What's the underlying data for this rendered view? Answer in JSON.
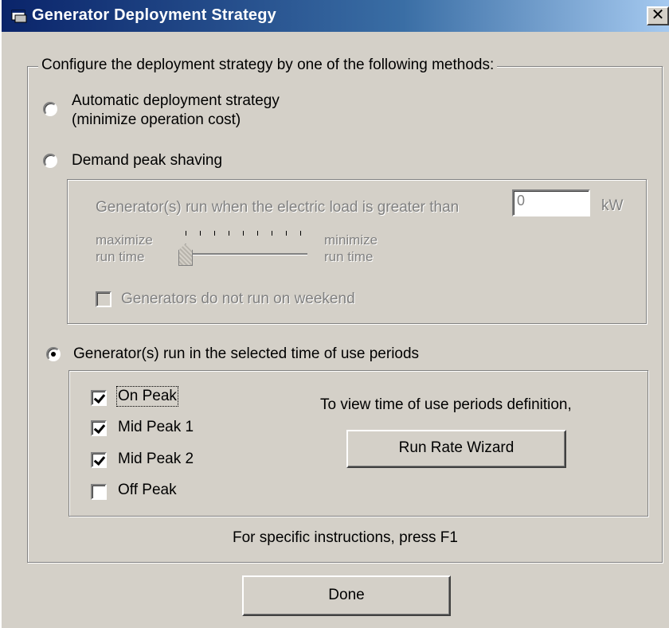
{
  "window": {
    "title": "Generator Deployment Strategy",
    "close_glyph": "✕"
  },
  "group": {
    "legend": "Configure the deployment strategy by one of the following methods:"
  },
  "options": {
    "automatic": {
      "line1": "Automatic deployment strategy",
      "line2": "(minimize operation cost)",
      "selected": false
    },
    "peak_shaving": {
      "label": "Demand peak shaving",
      "selected": false
    },
    "tou": {
      "label": "Generator(s) run in the selected time of use periods",
      "selected": true
    }
  },
  "peak_shaving": {
    "load_text": "Generator(s) run when the electric load is greater than",
    "threshold_value": "0",
    "unit": "kW",
    "slider_left_line1": "maximize",
    "slider_left_line2": "run time",
    "slider_right_line1": "minimize",
    "slider_right_line2": "run time",
    "slider_level_fraction": 0.0,
    "weekend_label": "Generators do not run on weekend",
    "weekend_checked": false
  },
  "tou_periods": [
    {
      "label": "On Peak",
      "checked": true
    },
    {
      "label": "Mid Peak 1",
      "checked": true
    },
    {
      "label": "Mid Peak 2",
      "checked": true
    },
    {
      "label": "Off Peak",
      "checked": false
    }
  ],
  "wizard": {
    "hint": "To view time of use periods definition,",
    "button_label": "Run Rate Wizard"
  },
  "footer": {
    "help_text": "For specific instructions, press F1",
    "done_label": "Done"
  }
}
